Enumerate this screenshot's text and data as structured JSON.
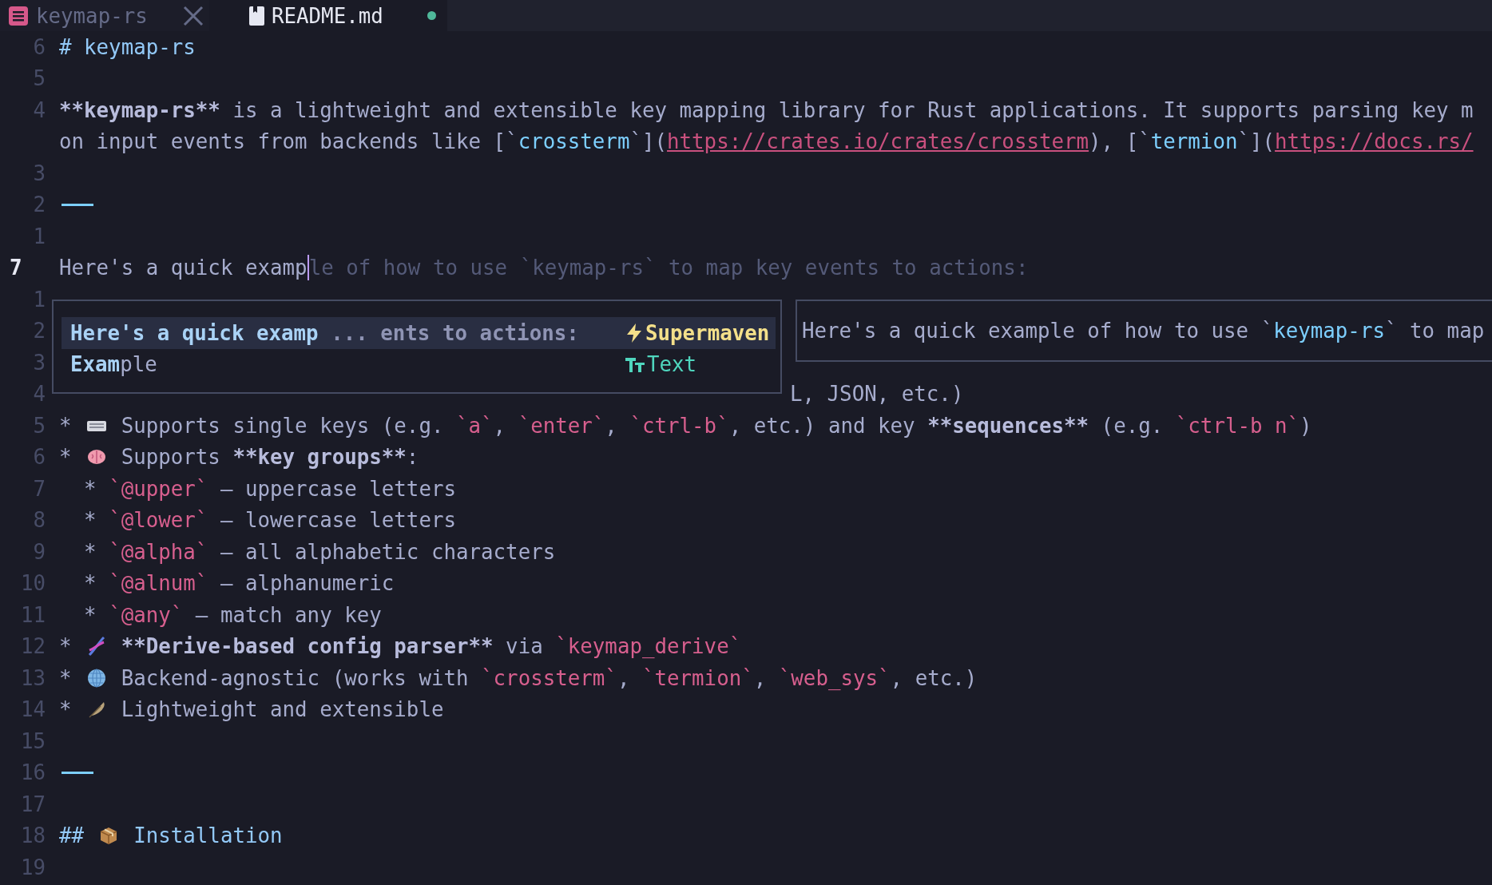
{
  "tabs": [
    {
      "label": "keymap-rs",
      "kind": "project",
      "selected": false,
      "modified": false
    },
    {
      "label": "README.md",
      "kind": "file",
      "selected": true,
      "modified": true
    }
  ],
  "lines": [
    {
      "number": "6",
      "kind": "text",
      "segments": [
        {
          "kind": "heading",
          "text": "# keymap-rs"
        }
      ]
    },
    {
      "number": "5",
      "kind": "text"
    },
    {
      "number": "4",
      "kind": "text",
      "segments": [
        {
          "kind": "bold",
          "text": "**keymap-rs**"
        },
        {
          "kind": "text",
          "text": " is a lightweight and extensible key mapping library for Rust applications. It supports parsing key m"
        }
      ]
    },
    {
      "kind": "text",
      "segments": [
        {
          "kind": "text",
          "text": "on input events from backends like [`"
        },
        {
          "kind": "link_code",
          "text": "crossterm"
        },
        {
          "kind": "text",
          "text": "`]("
        },
        {
          "kind": "url",
          "text": "https://crates.io/crates/crossterm"
        },
        {
          "kind": "text",
          "text": "), [`"
        },
        {
          "kind": "link_code",
          "text": "termion"
        },
        {
          "kind": "text",
          "text": "`]("
        },
        {
          "kind": "url",
          "text": "https://docs.rs/"
        }
      ]
    },
    {
      "number": "3",
      "kind": "text"
    },
    {
      "number": "2",
      "kind": "text",
      "segments": [
        {
          "kind": "rule"
        }
      ]
    },
    {
      "number": "1",
      "kind": "text"
    },
    {
      "number": "7",
      "kind": "current",
      "segments": [
        {
          "kind": "text",
          "text": "Here's a quick examp"
        },
        {
          "kind": "cursor"
        },
        {
          "kind": "ghost",
          "text": "le of how to use `keymap-rs` to map key events to actions:"
        }
      ]
    },
    {
      "number": "1",
      "kind": "text"
    },
    {
      "number": "2",
      "kind": "text"
    },
    {
      "number": "3",
      "kind": "text"
    },
    {
      "number": "4",
      "kind": "partial",
      "segments": [
        {
          "kind": "text",
          "text": "L, JSON, etc.)"
        }
      ]
    },
    {
      "number": "5",
      "kind": "text",
      "segments": [
        {
          "kind": "text",
          "text": "* "
        },
        {
          "kind": "keyboard_emoji"
        },
        {
          "kind": "text",
          "text": " Supports single keys (e.g. "
        },
        {
          "kind": "code",
          "text": "`a`"
        },
        {
          "kind": "text",
          "text": ", "
        },
        {
          "kind": "code",
          "text": "`enter`"
        },
        {
          "kind": "text",
          "text": ", "
        },
        {
          "kind": "code",
          "text": "`ctrl-b`"
        },
        {
          "kind": "text",
          "text": ", etc.) and key "
        },
        {
          "kind": "bold",
          "text": "**sequences**"
        },
        {
          "kind": "text",
          "text": " (e.g. "
        },
        {
          "kind": "code",
          "text": "`ctrl-b n`"
        },
        {
          "kind": "text",
          "text": ")"
        }
      ]
    },
    {
      "number": "6",
      "kind": "text",
      "segments": [
        {
          "kind": "text",
          "text": "* "
        },
        {
          "kind": "brain_emoji"
        },
        {
          "kind": "text",
          "text": " Supports "
        },
        {
          "kind": "bold",
          "text": "**key groups**"
        },
        {
          "kind": "text",
          "text": ":"
        }
      ]
    },
    {
      "number": "7",
      "kind": "text",
      "segments": [
        {
          "kind": "text",
          "text": "  * "
        },
        {
          "kind": "code",
          "text": "`@upper`"
        },
        {
          "kind": "text",
          "text": " – uppercase letters"
        }
      ]
    },
    {
      "number": "8",
      "kind": "text",
      "segments": [
        {
          "kind": "text",
          "text": "  * "
        },
        {
          "kind": "code",
          "text": "`@lower`"
        },
        {
          "kind": "text",
          "text": " – lowercase letters"
        }
      ]
    },
    {
      "number": "9",
      "kind": "text",
      "segments": [
        {
          "kind": "text",
          "text": "  * "
        },
        {
          "kind": "code",
          "text": "`@alpha`"
        },
        {
          "kind": "text",
          "text": " – all alphabetic characters"
        }
      ]
    },
    {
      "number": "10",
      "kind": "text",
      "segments": [
        {
          "kind": "text",
          "text": "  * "
        },
        {
          "kind": "code",
          "text": "`@alnum`"
        },
        {
          "kind": "text",
          "text": " – alphanumeric"
        }
      ]
    },
    {
      "number": "11",
      "kind": "text",
      "segments": [
        {
          "kind": "text",
          "text": "  * "
        },
        {
          "kind": "code",
          "text": "`@any`"
        },
        {
          "kind": "text",
          "text": " – match any key"
        }
      ]
    },
    {
      "number": "12",
      "kind": "text",
      "segments": [
        {
          "kind": "text",
          "text": "* "
        },
        {
          "kind": "dna_emoji"
        },
        {
          "kind": "bold",
          "text": " **Derive-based config parser**"
        },
        {
          "kind": "text",
          "text": " via "
        },
        {
          "kind": "code",
          "text": "`keymap_derive`"
        }
      ]
    },
    {
      "number": "13",
      "kind": "text",
      "segments": [
        {
          "kind": "text",
          "text": "* "
        },
        {
          "kind": "globe_emoji"
        },
        {
          "kind": "text",
          "text": " Backend-agnostic (works with "
        },
        {
          "kind": "code",
          "text": "`crossterm`"
        },
        {
          "kind": "text",
          "text": ", "
        },
        {
          "kind": "code",
          "text": "`termion`"
        },
        {
          "kind": "text",
          "text": ", "
        },
        {
          "kind": "code",
          "text": "`web_sys`"
        },
        {
          "kind": "text",
          "text": ", etc.)"
        }
      ]
    },
    {
      "number": "14",
      "kind": "text",
      "segments": [
        {
          "kind": "text",
          "text": "* "
        },
        {
          "kind": "feather_emoji"
        },
        {
          "kind": "text",
          "text": " Lightweight and extensible"
        }
      ]
    },
    {
      "number": "15",
      "kind": "text"
    },
    {
      "number": "16",
      "kind": "text",
      "segments": [
        {
          "kind": "rule"
        }
      ]
    },
    {
      "number": "17",
      "kind": "text"
    },
    {
      "number": "18",
      "kind": "text",
      "segments": [
        {
          "kind": "heading",
          "text": "## "
        },
        {
          "kind": "package_emoji"
        },
        {
          "kind": "heading",
          "text": " Installation"
        }
      ]
    },
    {
      "number": "19",
      "kind": "text"
    }
  ],
  "completion": {
    "items": [
      {
        "label": "**Here's a quick examp** ... ents to actions:",
        "source": "Supermaven",
        "kind": "ai",
        "selected": true
      },
      {
        "label": "**Exam**ple",
        "source": "Text",
        "kind": "text",
        "selected": false
      }
    ],
    "documentation": [
      {
        "kind": "text",
        "text": "Here's a quick example of how to use `"
      },
      {
        "kind": "link_code",
        "text": "keymap-rs"
      },
      {
        "kind": "text",
        "text": "` to map"
      }
    ]
  }
}
